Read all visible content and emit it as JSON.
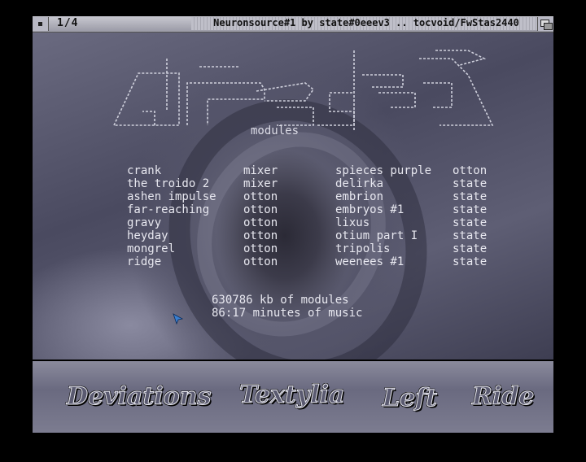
{
  "window": {
    "page_indicator": "1/4",
    "title": "Neuronsource#1 by state#0eeev3 .. tocvoid/FwStas2440"
  },
  "logo": {
    "label": "modules"
  },
  "modules": [
    {
      "name": "crank",
      "author": "mixer",
      "name2": "spieces purple",
      "author2": "otton"
    },
    {
      "name": "the troido 2",
      "author": "mixer",
      "name2": "delirka",
      "author2": "state"
    },
    {
      "name": "ashen impulse",
      "author": "otton",
      "name2": "embrion",
      "author2": "state"
    },
    {
      "name": "far-reaching",
      "author": "otton",
      "name2": "embryos #1",
      "author2": "state"
    },
    {
      "name": "gravy",
      "author": "otton",
      "name2": "lixus",
      "author2": "state"
    },
    {
      "name": "heyday",
      "author": "otton",
      "name2": "otium part I",
      "author2": "state"
    },
    {
      "name": "mongrel",
      "author": "otton",
      "name2": "tripolis",
      "author2": "state"
    },
    {
      "name": "ridge",
      "author": "otton",
      "name2": "weenees #1",
      "author2": "state"
    }
  ],
  "stats": {
    "size": "630786 kb of modules",
    "duration": "86:17 minutes of music"
  },
  "nav": {
    "deviations": "Deviations",
    "textylia": "Textylia",
    "left": "Left",
    "ride": "Ride"
  },
  "colors": {
    "text": "#e8e8f0",
    "background": "#000000",
    "cursor": "#3a7fd0"
  }
}
